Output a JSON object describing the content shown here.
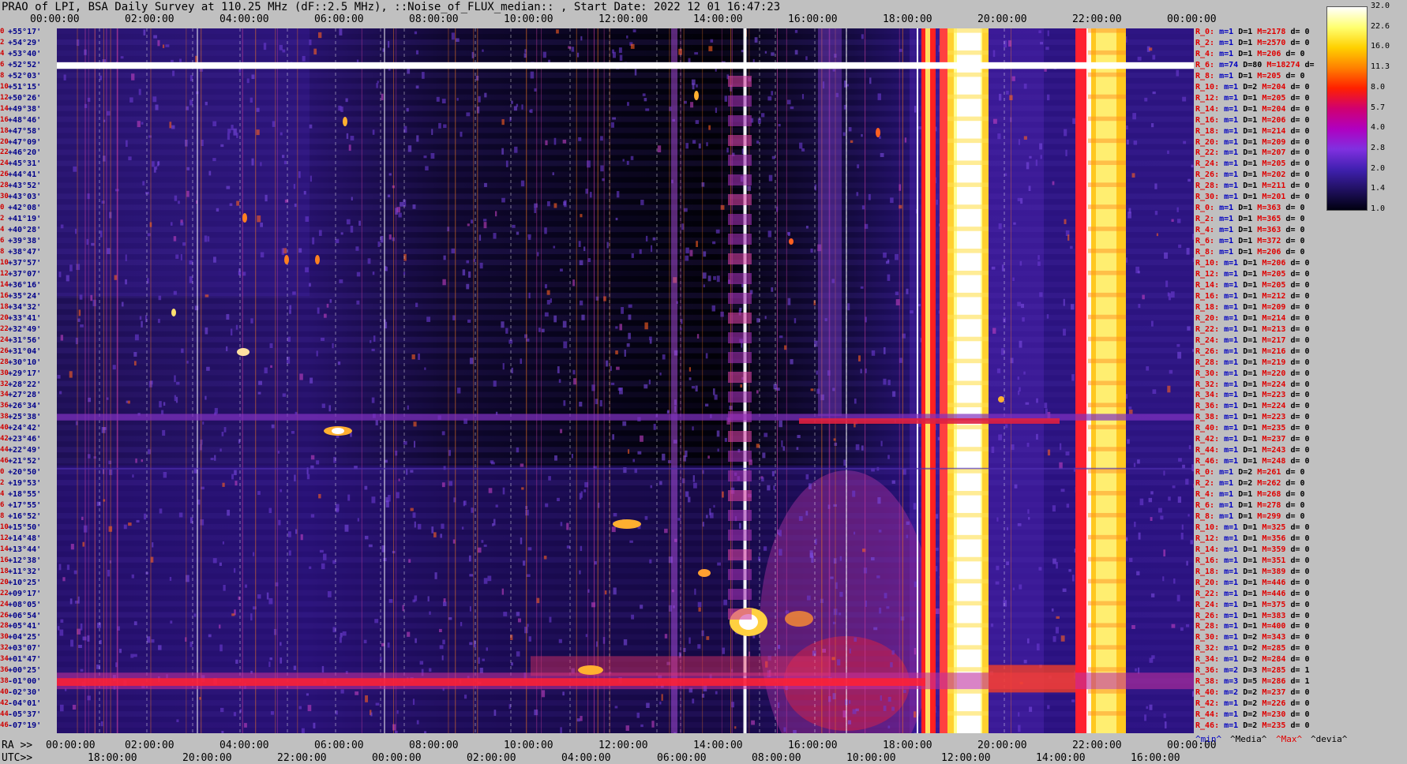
{
  "title": "PRAO of LPI, BSA Daily Survey at 110.25 MHz (dF::2.5 MHz), ::Noise_of_FLUX_median:: , Start Date: 2022 12 01 16:47:23",
  "axes": {
    "top_ticks": [
      "00:00:00",
      "02:00:00",
      "04:00:00",
      "06:00:00",
      "08:00:00",
      "10:00:00",
      "12:00:00",
      "14:00:00",
      "16:00:00",
      "18:00:00",
      "20:00:00",
      "22:00:00",
      "00:00:00"
    ],
    "ra_prefix": "RA >>",
    "ra_ticks": [
      "00:00:00",
      "02:00:00",
      "04:00:00",
      "06:00:00",
      "08:00:00",
      "10:00:00",
      "12:00:00",
      "14:00:00",
      "16:00:00",
      "18:00:00",
      "20:00:00",
      "22:00:00",
      "00:00:00"
    ],
    "utc_prefix": "UTC>>",
    "utc_ticks": [
      "18:00:00",
      "20:00:00",
      "22:00:00",
      "00:00:00",
      "02:00:00",
      "04:00:00",
      "06:00:00",
      "08:00:00",
      "10:00:00",
      "12:00:00",
      "14:00:00",
      "16:00:00"
    ]
  },
  "colorbar": {
    "ticks": [
      "32.0",
      "22.6",
      "16.0",
      "11.3",
      "8.0",
      "5.7",
      "4.0",
      "2.8",
      "2.0",
      "1.4",
      "1.0"
    ],
    "colors": [
      "#ffffff",
      "#ffff70",
      "#ffd000",
      "#ff8000",
      "#ff2000",
      "#d00070",
      "#b000c0",
      "#8030e0",
      "#4020b0",
      "#201060",
      "#000010"
    ]
  },
  "footer_legend": [
    {
      "text": "^min^",
      "color": "#0000c0"
    },
    {
      "text": "^Media^",
      "color": "#000000"
    },
    {
      "text": "^Max^",
      "color": "#e00000"
    },
    {
      "text": "^devia^",
      "color": "#000000"
    }
  ],
  "chart_data": {
    "type": "heatmap",
    "title": "PRAO of LPI, BSA Daily Survey at 110.25 MHz (dF::2.5 MHz), ::Noise_of_FLUX_median:: , Start Date: 2022 12 01 16:47:23",
    "x_axis_top": "Sidereal time 00:00:00 – 24:00:00",
    "x_axis_bottom_ra": "RA 00:00:00 – 24:00:00",
    "x_axis_bottom_utc": "UTC 18:00:00 – 16:00:00",
    "color_scale": "log",
    "color_range": [
      1.0,
      32.0
    ],
    "rows": [
      {
        "idx": "0",
        "dec": "+55°17'"
      },
      {
        "idx": "2",
        "dec": "+54°29'"
      },
      {
        "idx": "4",
        "dec": "+53°40'"
      },
      {
        "idx": "6",
        "dec": "+52°52'"
      },
      {
        "idx": "8",
        "dec": "+52°03'"
      },
      {
        "idx": "10",
        "dec": "+51°15'"
      },
      {
        "idx": "12",
        "dec": "+50°26'"
      },
      {
        "idx": "14",
        "dec": "+49°38'"
      },
      {
        "idx": "16",
        "dec": "+48°46'"
      },
      {
        "idx": "18",
        "dec": "+47°58'"
      },
      {
        "idx": "20",
        "dec": "+47°09'"
      },
      {
        "idx": "22",
        "dec": "+46°20'"
      },
      {
        "idx": "24",
        "dec": "+45°31'"
      },
      {
        "idx": "26",
        "dec": "+44°41'"
      },
      {
        "idx": "28",
        "dec": "+43°52'"
      },
      {
        "idx": "30",
        "dec": "+43°03'"
      },
      {
        "idx": "0",
        "dec": "+42°08'"
      },
      {
        "idx": "2",
        "dec": "+41°19'"
      },
      {
        "idx": "4",
        "dec": "+40°28'"
      },
      {
        "idx": "6",
        "dec": "+39°38'"
      },
      {
        "idx": "8",
        "dec": "+38°47'"
      },
      {
        "idx": "10",
        "dec": "+37°57'"
      },
      {
        "idx": "12",
        "dec": "+37°07'"
      },
      {
        "idx": "14",
        "dec": "+36°16'"
      },
      {
        "idx": "16",
        "dec": "+35°24'"
      },
      {
        "idx": "18",
        "dec": "+34°32'"
      },
      {
        "idx": "20",
        "dec": "+33°41'"
      },
      {
        "idx": "22",
        "dec": "+32°49'"
      },
      {
        "idx": "24",
        "dec": "+31°56'"
      },
      {
        "idx": "26",
        "dec": "+31°04'"
      },
      {
        "idx": "28",
        "dec": "+30°10'"
      },
      {
        "idx": "30",
        "dec": "+29°17'"
      },
      {
        "idx": "32",
        "dec": "+28°22'"
      },
      {
        "idx": "34",
        "dec": "+27°28'"
      },
      {
        "idx": "36",
        "dec": "+26°34'"
      },
      {
        "idx": "38",
        "dec": "+25°38'"
      },
      {
        "idx": "40",
        "dec": "+24°42'"
      },
      {
        "idx": "42",
        "dec": "+23°46'"
      },
      {
        "idx": "44",
        "dec": "+22°49'"
      },
      {
        "idx": "46",
        "dec": "+21°52'"
      },
      {
        "idx": "0",
        "dec": "+20°50'"
      },
      {
        "idx": "2",
        "dec": "+19°53'"
      },
      {
        "idx": "4",
        "dec": "+18°55'"
      },
      {
        "idx": "6",
        "dec": "+17°55'"
      },
      {
        "idx": "8",
        "dec": "+16°52'"
      },
      {
        "idx": "10",
        "dec": "+15°50'"
      },
      {
        "idx": "12",
        "dec": "+14°48'"
      },
      {
        "idx": "14",
        "dec": "+13°44'"
      },
      {
        "idx": "16",
        "dec": "+12°38'"
      },
      {
        "idx": "18",
        "dec": "+11°32'"
      },
      {
        "idx": "20",
        "dec": "+10°25'"
      },
      {
        "idx": "22",
        "dec": "+09°17'"
      },
      {
        "idx": "24",
        "dec": "+08°05'"
      },
      {
        "idx": "26",
        "dec": "+06°54'"
      },
      {
        "idx": "28",
        "dec": "+05°41'"
      },
      {
        "idx": "30",
        "dec": "+04°25'"
      },
      {
        "idx": "32",
        "dec": "+03°07'"
      },
      {
        "idx": "34",
        "dec": "+01°47'"
      },
      {
        "idx": "36",
        "dec": "+00°25'"
      },
      {
        "idx": "38",
        "dec": "-01°00'"
      },
      {
        "idx": "40",
        "dec": "-02°30'"
      },
      {
        "idx": "42",
        "dec": "-04°01'"
      },
      {
        "idx": "44",
        "dec": "-05°37'"
      },
      {
        "idx": "46",
        "dec": "-07°19'"
      }
    ],
    "row_stats": [
      {
        "ch": "R_0:",
        "m": "1",
        "D": "1",
        "M": "2178",
        "d": "0"
      },
      {
        "ch": "R_2:",
        "m": "1",
        "D": "1",
        "M": "2570",
        "d": "0"
      },
      {
        "ch": "R_4:",
        "m": "1",
        "D": "1",
        "M": "206",
        "d": "0"
      },
      {
        "ch": "R_6:",
        "m": "74",
        "D": "80",
        "M": "18274",
        "d": ""
      },
      {
        "ch": "R_8:",
        "m": "1",
        "D": "1",
        "M": "205",
        "d": "0"
      },
      {
        "ch": "R_10:",
        "m": "1",
        "D": "2",
        "M": "204",
        "d": "0"
      },
      {
        "ch": "R_12:",
        "m": "1",
        "D": "1",
        "M": "205",
        "d": "0"
      },
      {
        "ch": "R_14:",
        "m": "1",
        "D": "1",
        "M": "204",
        "d": "0"
      },
      {
        "ch": "R_16:",
        "m": "1",
        "D": "1",
        "M": "206",
        "d": "0"
      },
      {
        "ch": "R_18:",
        "m": "1",
        "D": "1",
        "M": "214",
        "d": "0"
      },
      {
        "ch": "R_20:",
        "m": "1",
        "D": "1",
        "M": "209",
        "d": "0"
      },
      {
        "ch": "R_22:",
        "m": "1",
        "D": "1",
        "M": "207",
        "d": "0"
      },
      {
        "ch": "R_24:",
        "m": "1",
        "D": "1",
        "M": "205",
        "d": "0"
      },
      {
        "ch": "R_26:",
        "m": "1",
        "D": "1",
        "M": "202",
        "d": "0"
      },
      {
        "ch": "R_28:",
        "m": "1",
        "D": "1",
        "M": "211",
        "d": "0"
      },
      {
        "ch": "R_30:",
        "m": "1",
        "D": "1",
        "M": "201",
        "d": "0"
      },
      {
        "ch": "R_0:",
        "m": "1",
        "D": "1",
        "M": "363",
        "d": "0"
      },
      {
        "ch": "R_2:",
        "m": "1",
        "D": "1",
        "M": "365",
        "d": "0"
      },
      {
        "ch": "R_4:",
        "m": "1",
        "D": "1",
        "M": "363",
        "d": "0"
      },
      {
        "ch": "R_6:",
        "m": "1",
        "D": "1",
        "M": "372",
        "d": "0"
      },
      {
        "ch": "R_8:",
        "m": "1",
        "D": "1",
        "M": "206",
        "d": "0"
      },
      {
        "ch": "R_10:",
        "m": "1",
        "D": "1",
        "M": "206",
        "d": "0"
      },
      {
        "ch": "R_12:",
        "m": "1",
        "D": "1",
        "M": "205",
        "d": "0"
      },
      {
        "ch": "R_14:",
        "m": "1",
        "D": "1",
        "M": "205",
        "d": "0"
      },
      {
        "ch": "R_16:",
        "m": "1",
        "D": "1",
        "M": "212",
        "d": "0"
      },
      {
        "ch": "R_18:",
        "m": "1",
        "D": "1",
        "M": "209",
        "d": "0"
      },
      {
        "ch": "R_20:",
        "m": "1",
        "D": "1",
        "M": "214",
        "d": "0"
      },
      {
        "ch": "R_22:",
        "m": "1",
        "D": "1",
        "M": "213",
        "d": "0"
      },
      {
        "ch": "R_24:",
        "m": "1",
        "D": "1",
        "M": "217",
        "d": "0"
      },
      {
        "ch": "R_26:",
        "m": "1",
        "D": "1",
        "M": "216",
        "d": "0"
      },
      {
        "ch": "R_28:",
        "m": "1",
        "D": "1",
        "M": "219",
        "d": "0"
      },
      {
        "ch": "R_30:",
        "m": "1",
        "D": "1",
        "M": "220",
        "d": "0"
      },
      {
        "ch": "R_32:",
        "m": "1",
        "D": "1",
        "M": "224",
        "d": "0"
      },
      {
        "ch": "R_34:",
        "m": "1",
        "D": "1",
        "M": "223",
        "d": "0"
      },
      {
        "ch": "R_36:",
        "m": "1",
        "D": "1",
        "M": "224",
        "d": "0"
      },
      {
        "ch": "R_38:",
        "m": "1",
        "D": "1",
        "M": "223",
        "d": "0"
      },
      {
        "ch": "R_40:",
        "m": "1",
        "D": "1",
        "M": "235",
        "d": "0"
      },
      {
        "ch": "R_42:",
        "m": "1",
        "D": "1",
        "M": "237",
        "d": "0"
      },
      {
        "ch": "R_44:",
        "m": "1",
        "D": "1",
        "M": "243",
        "d": "0"
      },
      {
        "ch": "R_46:",
        "m": "1",
        "D": "1",
        "M": "248",
        "d": "0"
      },
      {
        "ch": "R_0:",
        "m": "1",
        "D": "2",
        "M": "261",
        "d": "0"
      },
      {
        "ch": "R_2:",
        "m": "1",
        "D": "2",
        "M": "262",
        "d": "0"
      },
      {
        "ch": "R_4:",
        "m": "1",
        "D": "1",
        "M": "268",
        "d": "0"
      },
      {
        "ch": "R_6:",
        "m": "1",
        "D": "1",
        "M": "278",
        "d": "0"
      },
      {
        "ch": "R_8:",
        "m": "1",
        "D": "1",
        "M": "299",
        "d": "0"
      },
      {
        "ch": "R_10:",
        "m": "1",
        "D": "1",
        "M": "325",
        "d": "0"
      },
      {
        "ch": "R_12:",
        "m": "1",
        "D": "1",
        "M": "356",
        "d": "0"
      },
      {
        "ch": "R_14:",
        "m": "1",
        "D": "1",
        "M": "359",
        "d": "0"
      },
      {
        "ch": "R_16:",
        "m": "1",
        "D": "1",
        "M": "351",
        "d": "0"
      },
      {
        "ch": "R_18:",
        "m": "1",
        "D": "1",
        "M": "389",
        "d": "0"
      },
      {
        "ch": "R_20:",
        "m": "1",
        "D": "1",
        "M": "446",
        "d": "0"
      },
      {
        "ch": "R_22:",
        "m": "1",
        "D": "1",
        "M": "446",
        "d": "0"
      },
      {
        "ch": "R_24:",
        "m": "1",
        "D": "1",
        "M": "375",
        "d": "0"
      },
      {
        "ch": "R_26:",
        "m": "1",
        "D": "1",
        "M": "383",
        "d": "0"
      },
      {
        "ch": "R_28:",
        "m": "1",
        "D": "1",
        "M": "400",
        "d": "0"
      },
      {
        "ch": "R_30:",
        "m": "1",
        "D": "2",
        "M": "343",
        "d": "0"
      },
      {
        "ch": "R_32:",
        "m": "1",
        "D": "2",
        "M": "285",
        "d": "0"
      },
      {
        "ch": "R_34:",
        "m": "1",
        "D": "2",
        "M": "284",
        "d": "0"
      },
      {
        "ch": "R_36:",
        "m": "2",
        "D": "3",
        "M": "285",
        "d": "1"
      },
      {
        "ch": "R_38:",
        "m": "3",
        "D": "5",
        "M": "286",
        "d": "1"
      },
      {
        "ch": "R_40:",
        "m": "2",
        "D": "2",
        "M": "237",
        "d": "0"
      },
      {
        "ch": "R_42:",
        "m": "1",
        "D": "2",
        "M": "226",
        "d": "0"
      },
      {
        "ch": "R_44:",
        "m": "1",
        "D": "2",
        "M": "230",
        "d": "0"
      },
      {
        "ch": "R_46:",
        "m": "1",
        "D": "2",
        "M": "235",
        "d": "0"
      }
    ]
  }
}
